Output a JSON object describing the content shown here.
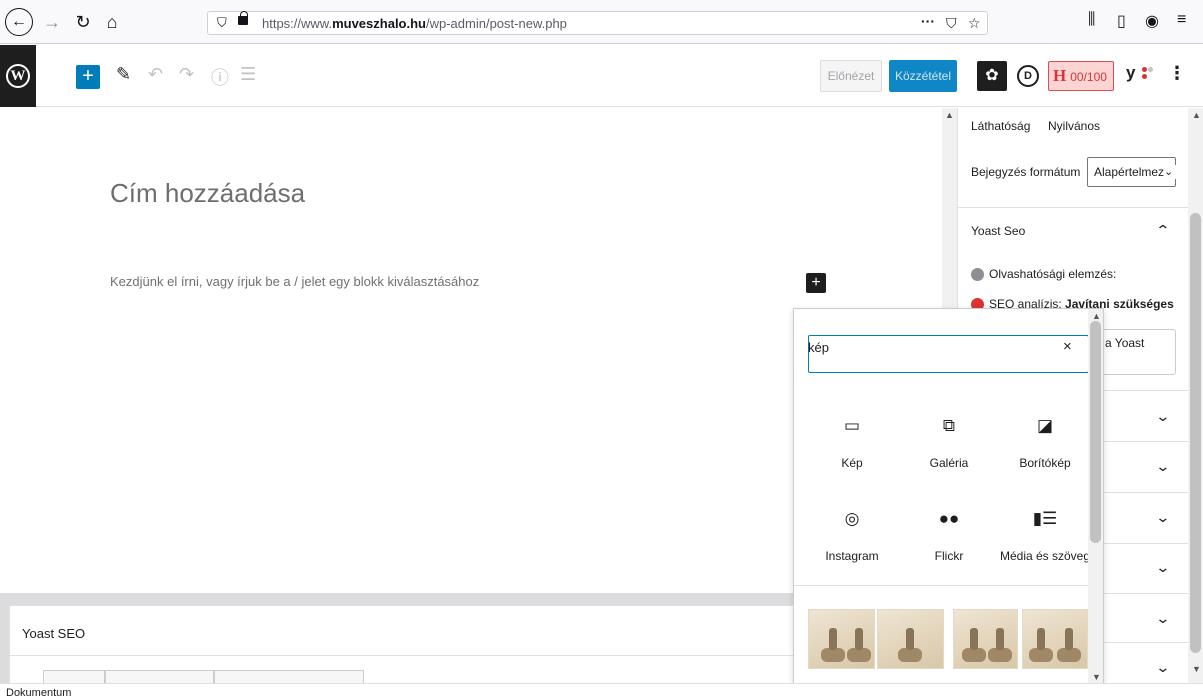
{
  "browser": {
    "url_prefix": "https://www.",
    "url_domain": "muveszhalo.hu",
    "url_path": "/wp-admin/post-new.php",
    "page_actions": "···",
    "back_icon": "arrow-left-icon",
    "forward_icon": "arrow-right-icon",
    "reload_icon": "reload-icon",
    "home_icon": "home-icon"
  },
  "toolbar": {
    "preview_label": "Előnézet",
    "publish_label": "Közzététel",
    "d_label": "D",
    "h_letter": "H",
    "seo_score": "00/100",
    "yoast_letter": "y",
    "more_label": "⋮"
  },
  "editor": {
    "title_placeholder": "Cím hozzáadása",
    "paragraph_placeholder": "Kezdjünk el írni, vagy írjuk be a / jelet egy blokk kiválasztásához"
  },
  "sidebar": {
    "visibility_label": "Láthatóság",
    "visibility_value": "Nyilvános",
    "format_label": "Bejegyzés formátum",
    "format_value": "Alapértelmezett",
    "yoast_panel_title": "Yoast Seo",
    "readability_label": "Olvashatósági elemzés:",
    "seo_label": "SEO analízis:",
    "seo_status": "Javítani szükséges",
    "yoast_button_label": "a Yoast",
    "readability_color": "#8c8f94",
    "seo_color": "#dc3232"
  },
  "inserter": {
    "search_value": "kép",
    "clear_label": "×",
    "blocks": [
      {
        "label": "Kép",
        "icon": "image-icon"
      },
      {
        "label": "Galéria",
        "icon": "gallery-icon"
      },
      {
        "label": "Borítókép",
        "icon": "cover-icon"
      },
      {
        "label": "Instagram",
        "icon": "instagram-icon"
      },
      {
        "label": "Flickr",
        "icon": "flickr-icon"
      },
      {
        "label": "Média és szöveg",
        "icon": "media-text-icon"
      }
    ]
  },
  "metabox": {
    "title": "Yoast SEO"
  },
  "status_bar": {
    "text": "Dokumentum"
  },
  "colors": {
    "accent": "#007cba",
    "wp_dark": "#1e1e1e",
    "score_bg": "#fcd4d4",
    "score_text": "#d63638"
  }
}
